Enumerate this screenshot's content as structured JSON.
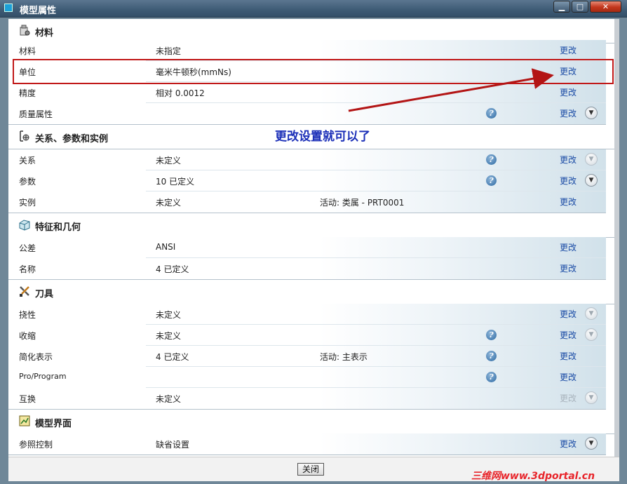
{
  "window": {
    "title": "模型属性"
  },
  "sections": {
    "material": {
      "title": "材料",
      "rows": [
        {
          "label": "材料",
          "value": "未指定",
          "action": "更改"
        },
        {
          "label": "单位",
          "value": "毫米牛顿秒(mmNs)",
          "action": "更改"
        },
        {
          "label": "精度",
          "value": "相对 0.0012",
          "action": "更改"
        },
        {
          "label": "质量属性",
          "action": "更改"
        }
      ]
    },
    "relations": {
      "title": "关系、参数和实例",
      "rows": [
        {
          "label": "关系",
          "value": "未定义",
          "action": "更改"
        },
        {
          "label": "参数",
          "value": "10 已定义",
          "action": "更改"
        },
        {
          "label": "实例",
          "value": "未定义",
          "extra": "活动: 类属 - PRT0001",
          "action": "更改"
        }
      ]
    },
    "features": {
      "title": "特征和几何",
      "rows": [
        {
          "label": "公差",
          "value": "ANSI",
          "action": "更改"
        },
        {
          "label": "名称",
          "value": "4 已定义",
          "action": "更改"
        }
      ]
    },
    "tools": {
      "title": "刀具",
      "rows": [
        {
          "label": "挠性",
          "value": "未定义",
          "action": "更改"
        },
        {
          "label": "收缩",
          "value": "未定义",
          "action": "更改"
        },
        {
          "label": "简化表示",
          "value": "4 已定义",
          "extra": "活动: 主表示",
          "action": "更改"
        },
        {
          "label": "Pro/Program",
          "action": "更改"
        },
        {
          "label": "互换",
          "value": "未定义",
          "action": "更改"
        }
      ]
    },
    "interface": {
      "title": "模型界面",
      "rows": [
        {
          "label": "参照控制",
          "value": "缺省设置",
          "action": "更改"
        }
      ]
    }
  },
  "annotation": {
    "text": "更改设置就可以了"
  },
  "footer": {
    "close_label": "关闭"
  },
  "watermark": "三维网www.3dportal.cn",
  "colors": {
    "link": "#1a4ba5",
    "annotation": "#1b2fb8",
    "highlight": "#c11818",
    "titlebar": "#3d5a74"
  }
}
